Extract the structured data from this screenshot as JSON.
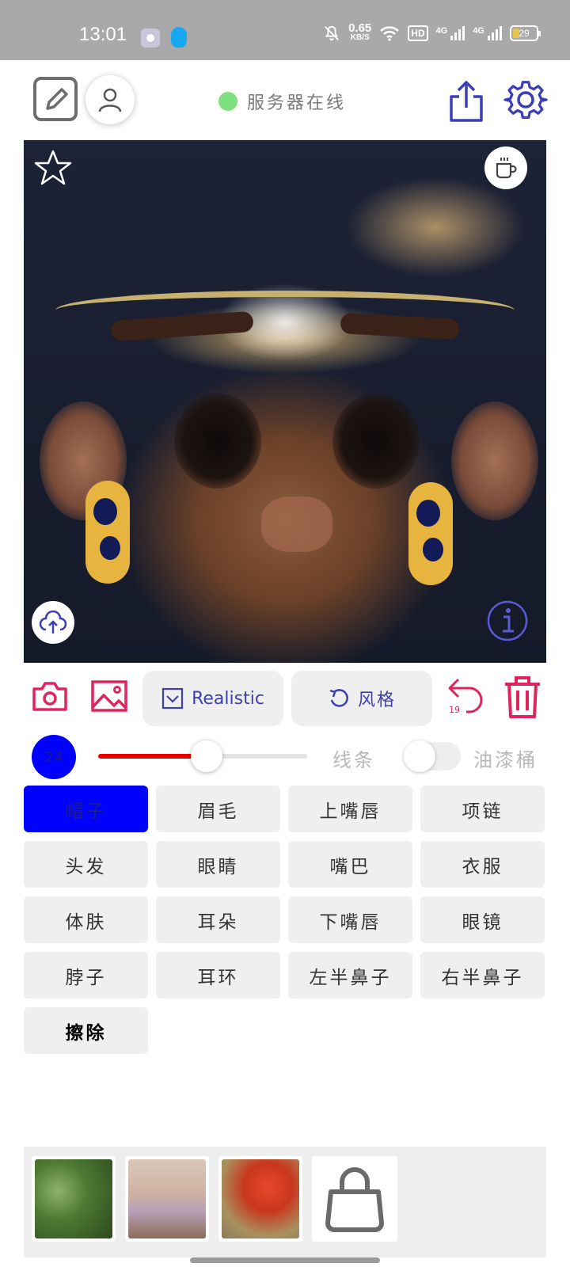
{
  "status_bar": {
    "time": "13:01",
    "net_speed_value": "0.65",
    "net_speed_unit": "KB/S",
    "hd_label": "HD",
    "sim1_label": "4G",
    "sim2_label": "4G",
    "battery_level": "29"
  },
  "header": {
    "server_status_text": "服务器在线",
    "server_status_color": "#7ee07e"
  },
  "toolbar": {
    "realistic_label": "Realistic",
    "style_label": "风格",
    "undo_count": "19",
    "accent_color": "#e0245e",
    "pill_text_color": "#3f3fae"
  },
  "brush": {
    "size": "24",
    "size_fraction": 0.52,
    "color": "#0000ff",
    "slider_color": "#e60000",
    "mode_lines": "线条",
    "mode_paint": "油漆桶",
    "paint_bucket_enabled": false
  },
  "labels": [
    {
      "text": "帽子",
      "selected": true
    },
    {
      "text": "眉毛",
      "selected": false
    },
    {
      "text": "上嘴唇",
      "selected": false
    },
    {
      "text": "项链",
      "selected": false
    },
    {
      "text": "头发",
      "selected": false
    },
    {
      "text": "眼睛",
      "selected": false
    },
    {
      "text": "嘴巴",
      "selected": false
    },
    {
      "text": "衣服",
      "selected": false
    },
    {
      "text": "体肤",
      "selected": false
    },
    {
      "text": "耳朵",
      "selected": false
    },
    {
      "text": "下嘴唇",
      "selected": false
    },
    {
      "text": "眼镜",
      "selected": false
    },
    {
      "text": "脖子",
      "selected": false
    },
    {
      "text": "耳环",
      "selected": false
    },
    {
      "text": "左半鼻子",
      "selected": false
    },
    {
      "text": "右半鼻子",
      "selected": false
    },
    {
      "text": "擦除",
      "selected": false,
      "erase": true
    }
  ],
  "icons": {
    "header": [
      "edit-icon",
      "user-icon",
      "share-icon",
      "settings-icon"
    ],
    "canvas": [
      "star-icon",
      "coffee-cup-icon",
      "cloud-upload-icon",
      "info-icon"
    ],
    "toolbar": [
      "camera-icon",
      "image-icon",
      "checkbox-icon",
      "refresh-icon",
      "undo-icon",
      "trash-icon"
    ],
    "tray": [
      "shopping-bag-icon"
    ]
  }
}
